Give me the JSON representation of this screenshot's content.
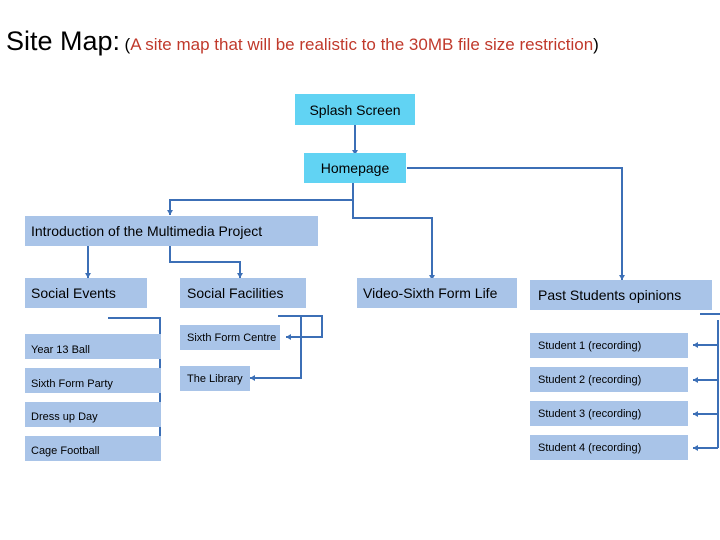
{
  "title": {
    "main": "Site Map:",
    "sub_open": "(",
    "sub_text": "A site map that will be realistic to the 30MB file size restriction",
    "sub_close": ")"
  },
  "colors": {
    "box_fill": "#a9c4e8",
    "highlight_fill": "#61d3f3",
    "connector": "#3c6fb6",
    "subtitle_text": "#c0392b"
  },
  "nodes": {
    "splash": "Splash Screen",
    "homepage": "Homepage",
    "intro": "Introduction of the Multimedia Project",
    "social_events": {
      "label": "Social Events",
      "children": [
        "Year 13 Ball",
        "Sixth Form Party",
        "Dress up Day",
        "Cage Football"
      ]
    },
    "social_facilities": {
      "label": "Social Facilities",
      "children": [
        "Sixth Form Centre",
        "The Library"
      ]
    },
    "video": "Video-Sixth Form Life",
    "past_students": {
      "label": "Past Students opinions",
      "children": [
        "Student 1 (recording)",
        "Student 2 (recording)",
        "Student 3 (recording)",
        "Student 4 (recording)"
      ]
    }
  }
}
